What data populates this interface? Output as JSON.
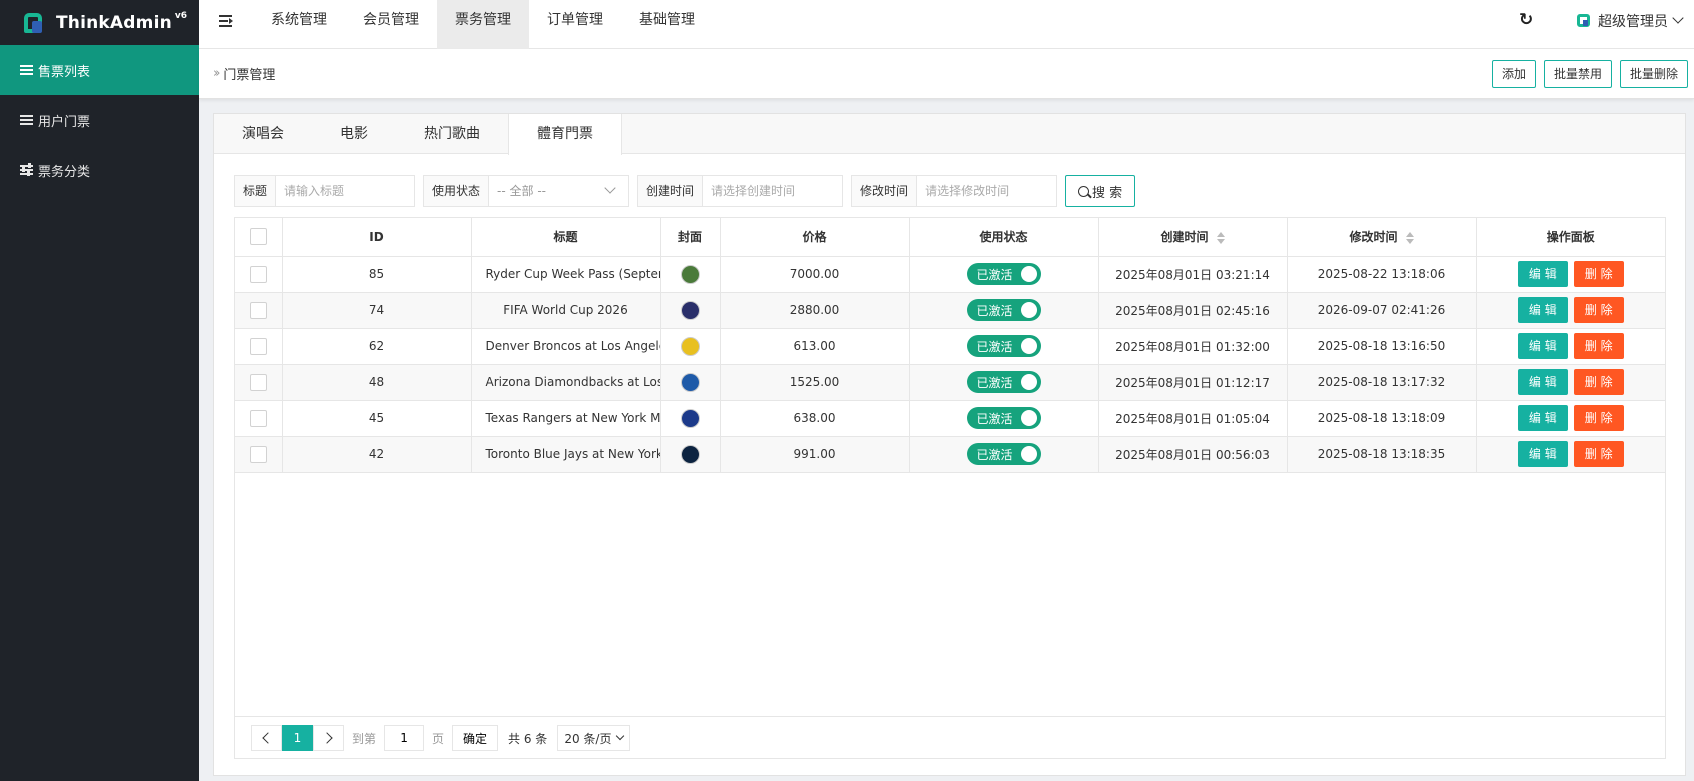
{
  "brand": {
    "name": "ThinkAdmin",
    "version": "v6"
  },
  "sidebar": {
    "items": [
      {
        "label": "售票列表",
        "active": true
      },
      {
        "label": "用户门票",
        "active": false
      },
      {
        "label": "票务分类",
        "active": false
      }
    ]
  },
  "topnav": {
    "items": [
      {
        "label": "系统管理",
        "active": false
      },
      {
        "label": "会员管理",
        "active": false
      },
      {
        "label": "票务管理",
        "active": true
      },
      {
        "label": "订单管理",
        "active": false
      },
      {
        "label": "基础管理",
        "active": false
      }
    ],
    "user": "超级管理员"
  },
  "breadcrumb": {
    "title": "门票管理"
  },
  "actions": {
    "add": "添加",
    "batch_disable": "批量禁用",
    "batch_delete": "批量删除"
  },
  "tabs": [
    {
      "label": "演唱会",
      "active": false
    },
    {
      "label": "电影",
      "active": false
    },
    {
      "label": "热门歌曲",
      "active": false
    },
    {
      "label": "體育門票",
      "active": true
    }
  ],
  "search": {
    "title_label": "标题",
    "title_placeholder": "请输入标题",
    "status_label": "使用状态",
    "status_value": "-- 全部 --",
    "created_label": "创建时间",
    "created_placeholder": "请选择创建时间",
    "modified_label": "修改时间",
    "modified_placeholder": "请选择修改时间",
    "button": "搜 索"
  },
  "table": {
    "headers": {
      "id": "ID",
      "title": "标题",
      "cover": "封面",
      "price": "价格",
      "status": "使用状态",
      "created": "创建时间",
      "modified": "修改时间",
      "ops": "操作面板"
    },
    "edit_label": "编 辑",
    "delete_label": "删 除",
    "rows": [
      {
        "id": "85",
        "title": "Ryder Cup Week Pass (Septemb",
        "price": "7000.00",
        "status": "已激活",
        "created": "2025年08月01日 03:21:14",
        "modified": "2025-08-22 13:18:06",
        "cover_color": "#4a7a3a"
      },
      {
        "id": "74",
        "title": "FIFA World Cup 2026",
        "price": "2880.00",
        "status": "已激活",
        "created": "2025年08月01日 02:45:16",
        "modified": "2026-09-07 02:41:26",
        "cover_color": "#2a2f6a"
      },
      {
        "id": "62",
        "title": "Denver Broncos at Los Angeles C",
        "price": "613.00",
        "status": "已激活",
        "created": "2025年08月01日 01:32:00",
        "modified": "2025-08-18 13:16:50",
        "cover_color": "#e8c020"
      },
      {
        "id": "48",
        "title": "Arizona Diamondbacks at Los An",
        "price": "1525.00",
        "status": "已激活",
        "created": "2025年08月01日 01:12:17",
        "modified": "2025-08-18 13:17:32",
        "cover_color": "#1e5aa8"
      },
      {
        "id": "45",
        "title": "Texas Rangers at New York Mets",
        "price": "638.00",
        "status": "已激活",
        "created": "2025年08月01日 01:05:04",
        "modified": "2025-08-18 13:18:09",
        "cover_color": "#1c3a8a"
      },
      {
        "id": "42",
        "title": "Toronto Blue Jays at New York Y",
        "price": "991.00",
        "status": "已激活",
        "created": "2025年08月01日 00:56:03",
        "modified": "2025-08-18 13:18:35",
        "cover_color": "#0c2340"
      }
    ]
  },
  "pager": {
    "current": "1",
    "goto_prefix": "到第",
    "goto_value": "1",
    "goto_suffix": "页",
    "confirm": "确定",
    "total": "共 6 条",
    "page_size": "20 条/页"
  }
}
